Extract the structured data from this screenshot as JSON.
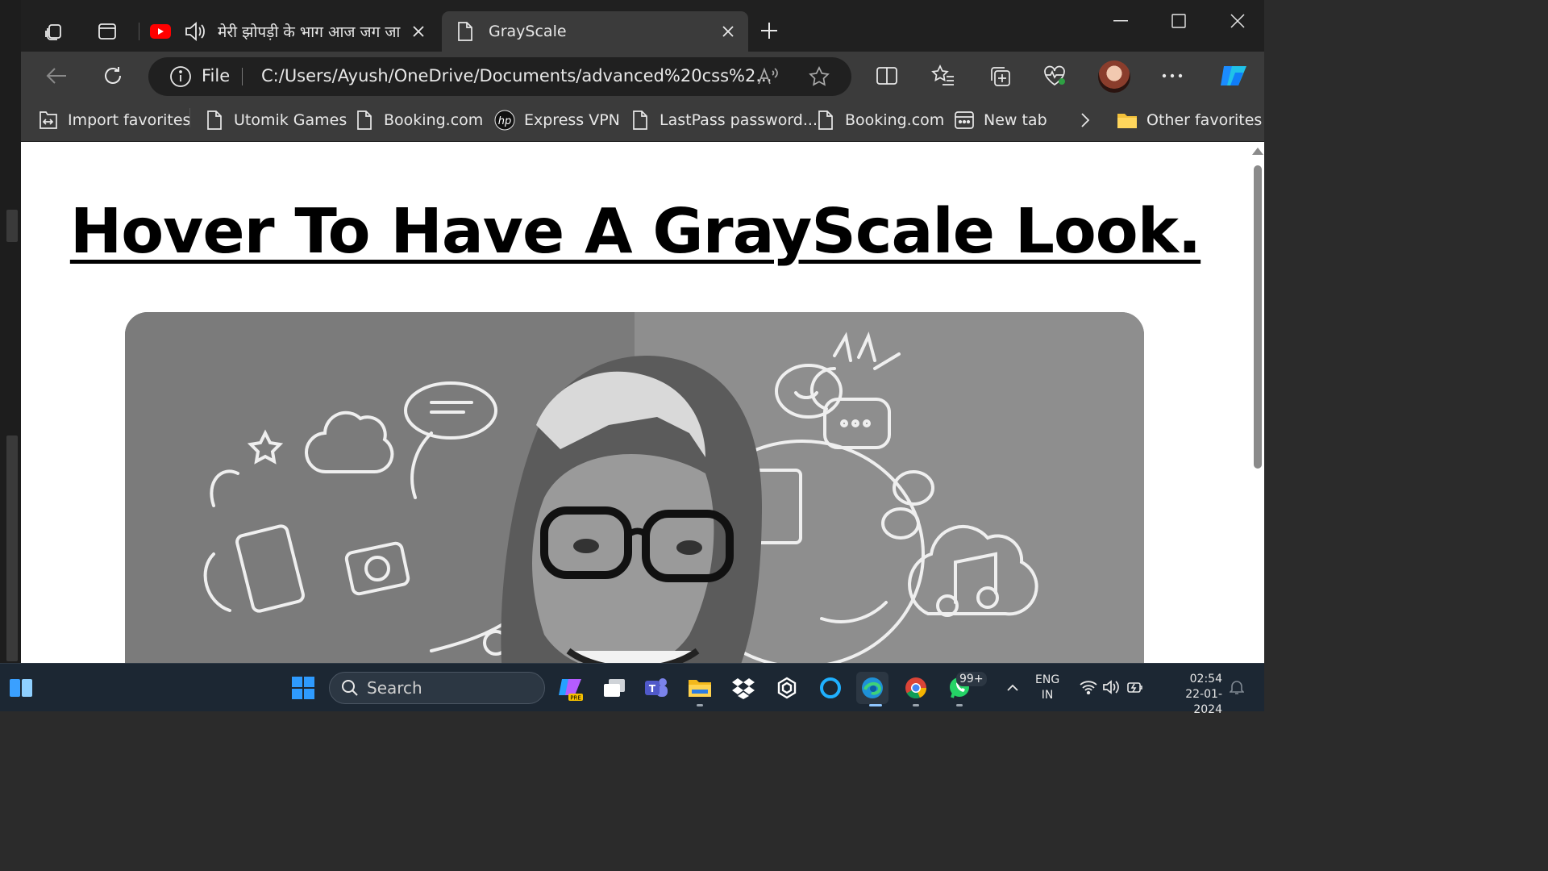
{
  "tabs": [
    {
      "title": "मेरी झोपड़ी के भाग आज जग जा",
      "active": false
    },
    {
      "title": "GrayScale",
      "active": true
    }
  ],
  "address": {
    "scheme": "File",
    "url": "C:/Users/Ayush/OneDrive/Documents/advanced%20css%2..."
  },
  "favorites": [
    {
      "label": "Import favorites",
      "icon": "import-icon"
    },
    {
      "label": "Utomik Games",
      "icon": "page-icon"
    },
    {
      "label": "Booking.com",
      "icon": "page-icon"
    },
    {
      "label": "Express VPN",
      "icon": "hp-logo-icon"
    },
    {
      "label": "LastPass password...",
      "icon": "page-icon"
    },
    {
      "label": "Booking.com",
      "icon": "page-icon"
    },
    {
      "label": "New tab",
      "icon": "newtab-icon"
    },
    {
      "label": "Other favorites",
      "icon": "folder-icon"
    }
  ],
  "page": {
    "heading": "Hover To Have A GrayScale Look."
  },
  "taskbar": {
    "search_placeholder": "Search",
    "notification_badge": "99+",
    "language": "ENG",
    "region": "IN",
    "time": "02:54",
    "date": "22-01-2024"
  },
  "colors": {
    "titlebar": "#202020",
    "toolbar": "#3b3b3b",
    "taskbar": "#1c2733",
    "accent": "#0a7cff",
    "youtube": "#ff0000"
  }
}
